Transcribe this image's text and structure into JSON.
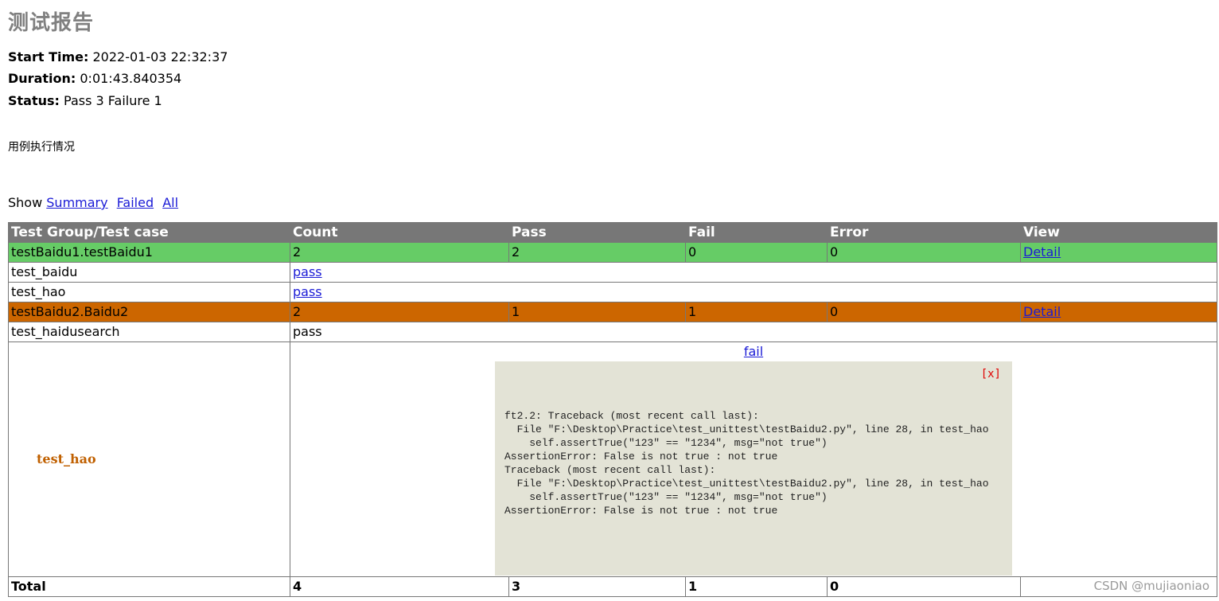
{
  "report": {
    "title": "测试报告",
    "attributes": [
      {
        "label": "Start Time:",
        "value": "2022-01-03 22:32:37"
      },
      {
        "label": "Duration:",
        "value": "0:01:43.840354"
      },
      {
        "label": "Status:",
        "value": "Pass 3 Failure 1"
      }
    ],
    "description": "用例执行情况"
  },
  "show": {
    "label": "Show",
    "links": [
      "Summary",
      "Failed",
      "All"
    ]
  },
  "table": {
    "headers": [
      "Test Group/Test case",
      "Count",
      "Pass",
      "Fail",
      "Error",
      "View"
    ],
    "groups": [
      {
        "name": "testBaidu1.testBaidu1",
        "count": "2",
        "pass": "2",
        "fail": "0",
        "error": "0",
        "view": "Detail",
        "status_color": "#66cc66",
        "cases": [
          {
            "name": "test_baidu",
            "result": "pass",
            "linked": true
          },
          {
            "name": "test_hao",
            "result": "pass",
            "linked": true
          }
        ]
      },
      {
        "name": "testBaidu2.Baidu2",
        "count": "2",
        "pass": "1",
        "fail": "1",
        "error": "0",
        "view": "Detail",
        "status_color": "#cc6600",
        "cases": [
          {
            "name": "test_haidusearch",
            "result": "pass",
            "linked": false
          },
          {
            "name": "test_hao",
            "result": "fail",
            "linked": true
          }
        ]
      }
    ],
    "total": {
      "label": "Total",
      "count": "4",
      "pass": "3",
      "fail": "1",
      "error": "0"
    }
  },
  "popup": {
    "close_label": "[x]",
    "traceback": "ft2.2: Traceback (most recent call last):\n  File \"F:\\Desktop\\Practice\\test_unittest\\testBaidu2.py\", line 28, in test_hao\n    self.assertTrue(\"123\" == \"1234\", msg=\"not true\")\nAssertionError: False is not true : not true\nTraceback (most recent call last):\n  File \"F:\\Desktop\\Practice\\test_unittest\\testBaidu2.py\", line 28, in test_hao\n    self.assertTrue(\"123\" == \"1234\", msg=\"not true\")\nAssertionError: False is not true : not true"
  },
  "watermark": "CSDN @mujiaoniao"
}
